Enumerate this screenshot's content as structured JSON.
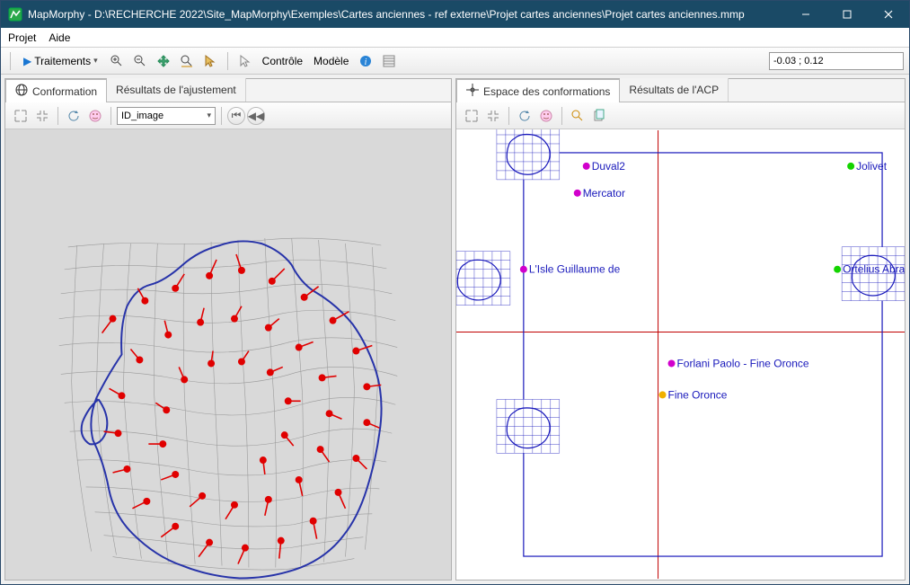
{
  "title": "MapMorphy - D:\\RECHERCHE 2022\\Site_MapMorphy\\Exemples\\Cartes anciennes - ref externe\\Projet cartes anciennes\\Projet cartes anciennes.mmp",
  "menu": {
    "project": "Projet",
    "help": "Aide"
  },
  "toolbar": {
    "treatments": "Traitements",
    "control": "Contrôle",
    "model": "Modèle"
  },
  "coords": "-0.03 ; 0.12",
  "left": {
    "tab1": "Conformation",
    "tab2": "Résultats de l'ajustement",
    "combo": "ID_image"
  },
  "right": {
    "tab1": "Espace des conformations",
    "tab2": "Résultats de l'ACP"
  },
  "chart_data": {
    "type": "scatter",
    "xlim": [
      -0.45,
      0.55
    ],
    "ylim": [
      -0.55,
      0.45
    ],
    "box": {
      "x1": -0.3,
      "y1": -0.5,
      "x2": 0.5,
      "y2": 0.4
    },
    "axis_x": 0,
    "axis_y": 0,
    "thumb_positions": [
      {
        "x": -0.29,
        "y": 0.4
      },
      {
        "x": -0.4,
        "y": 0.12
      },
      {
        "x": -0.29,
        "y": -0.21
      },
      {
        "x": 0.48,
        "y": 0.13
      }
    ],
    "series": [
      {
        "name": "Duval2",
        "x": -0.16,
        "y": 0.37,
        "color": "#d100cc"
      },
      {
        "name": "Mercator",
        "x": -0.18,
        "y": 0.31,
        "color": "#d100cc"
      },
      {
        "name": "L'Isle Guillaume de",
        "x": -0.3,
        "y": 0.14,
        "color": "#d100cc"
      },
      {
        "name": "Jolivet",
        "x": 0.43,
        "y": 0.37,
        "color": "#14d400"
      },
      {
        "name": "Ortelius Abraham",
        "x": 0.4,
        "y": 0.14,
        "color": "#14d400"
      },
      {
        "name": "Forlani Paolo - Fine Oronce",
        "x": 0.03,
        "y": -0.07,
        "color": "#d100cc"
      },
      {
        "name": "Fine Oronce",
        "x": 0.01,
        "y": -0.14,
        "color": "#f0b000"
      }
    ]
  },
  "left_chart": {
    "type": "map-morph",
    "landmark_count": 45,
    "note": "Warped thin-plate-spline grid over France outline with residual vectors (red)"
  }
}
